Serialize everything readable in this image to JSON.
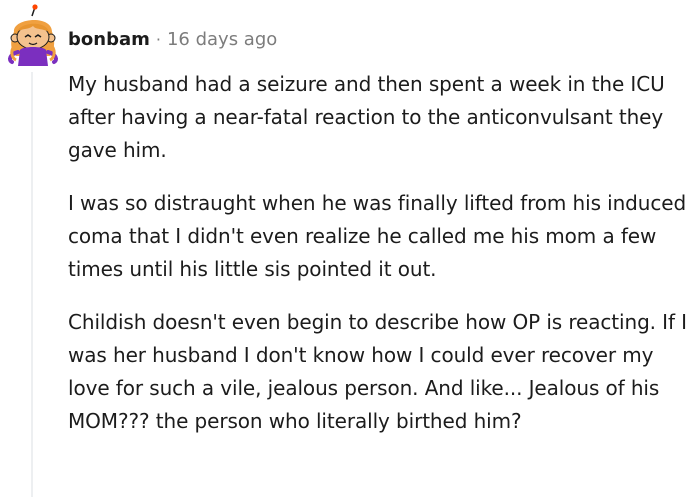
{
  "comment": {
    "username": "bonbam",
    "separator": "·",
    "timestamp": "16 days ago",
    "paragraphs": [
      "My husband had a seizure and then spent a week in the ICU after having a near-fatal reaction to the anticonvulsant they gave him.",
      "I was so distraught when he was finally lifted from his induced coma that I didn't even realize he called me his mom a few times until his little sis pointed it out.",
      "Childish doesn't even begin to describe how OP is reacting. If I was her husband I don't know how I could ever recover my love for such a vile, jealous person. And like... Jealous of his MOM??? the person who literally birthed him?"
    ]
  },
  "colors": {
    "text": "#1c1c1c",
    "meta": "#7c7c7c",
    "thread_line": "#edeff1",
    "avatar_hair": "#f0a040",
    "avatar_face": "#f4c28e",
    "avatar_shirt": "#7b2fbf"
  },
  "icons": {
    "avatar": "snoo-avatar-icon"
  }
}
